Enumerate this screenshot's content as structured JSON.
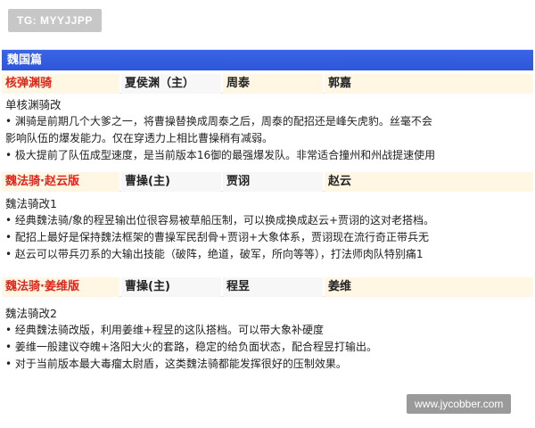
{
  "top_tag": "TG: MYYJJPP",
  "section_title": "魏国篇",
  "groups": [
    {
      "name": "核弹渊骑",
      "heroes": [
        "夏侯渊（主）",
        "周泰",
        "郭嘉"
      ],
      "subtitle": "单核渊骑改",
      "bullets": [
        "• 渊骑是前期几个大爹之一，将曹操替换成周泰之后，周泰的配招还是峰矢虎豹。丝毫不会",
        "影响队伍的爆发能力。仅在穿透力上相比曹操稍有减弱。",
        "• 极大提前了队伍成型速度，是当前版本16御的最强爆发队。非常适合撞州和州战提速使用"
      ]
    },
    {
      "name": "魏法骑·赵云版",
      "heroes": [
        "曹操(主)",
        "贾诩",
        "赵云"
      ],
      "subtitle": "魏法骑改1",
      "bullets": [
        "• 经典魏法骑/象的程昱输出位很容易被草船压制，可以换成换成赵云+贾诩的这对老搭档。",
        "• 配招上最好是保持魏法框架的曹操军民刮骨+贾诩+大象体系，贾诩现在流行奇正带兵无",
        "• 赵云可以带兵刃系的大输出技能（破阵，绝道，破军，所向等等），打法师肉队特别痛1"
      ]
    },
    {
      "name": "魏法骑·姜维版",
      "heroes": [
        "曹操(主)",
        "程昱",
        "姜维"
      ],
      "subtitle": "魏法骑改2",
      "bullets": [
        "• 经典魏法骑改版，利用姜维+程昱的这队搭档。可以带大象补硬度",
        "• 姜维一般建议夺魄+洛阳大火的套路，稳定的给负面状态，配合程昱打输出。",
        "• 对于当前版本最大毒瘤太尉盾，这类魏法骑都能发挥很好的压制效果。"
      ]
    }
  ],
  "watermark": "www.jycobber.com"
}
